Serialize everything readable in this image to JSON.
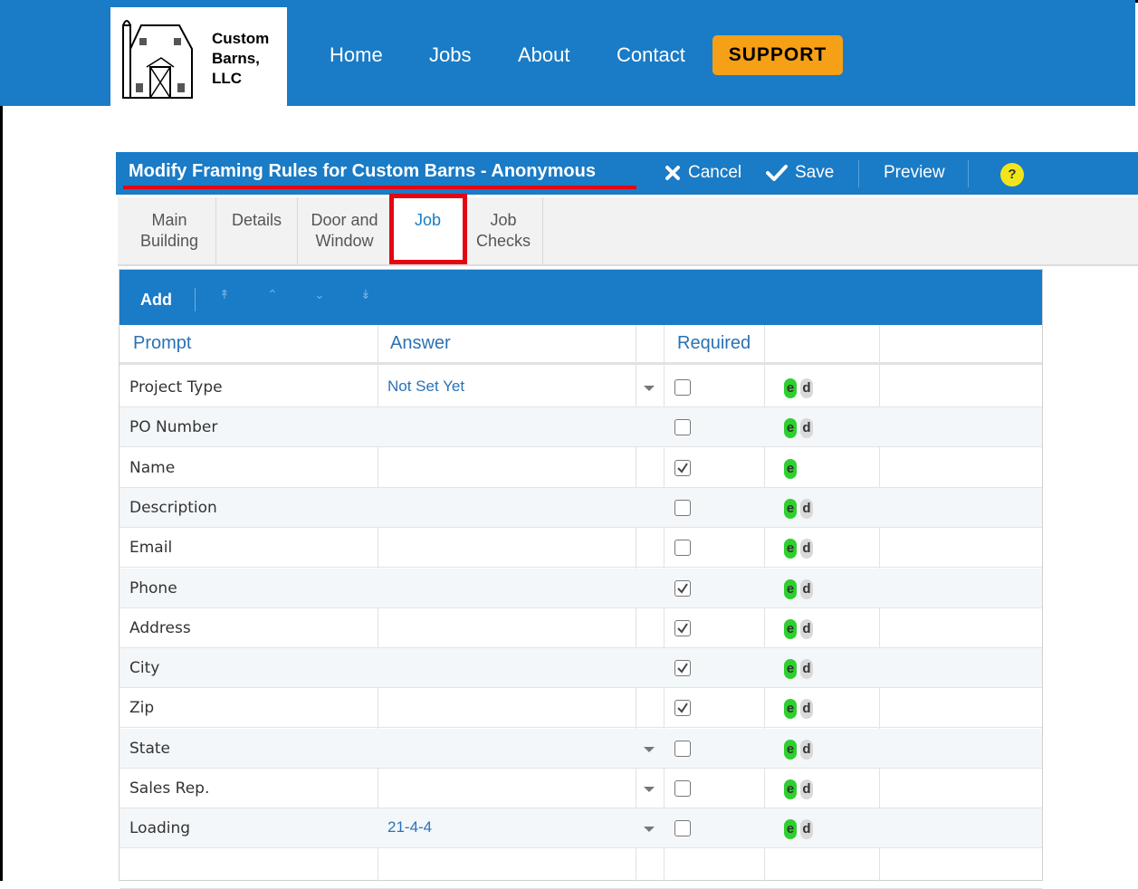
{
  "brand": {
    "logo_line1": "Custom",
    "logo_line2": "Barns,",
    "logo_line3": "LLC"
  },
  "nav": {
    "home": "Home",
    "jobs": "Jobs",
    "about": "About",
    "contact": "Contact",
    "support": "SUPPORT"
  },
  "titlebar": {
    "title": "Modify Framing Rules for Custom Barns - Anonymous",
    "cancel": "Cancel",
    "save": "Save",
    "preview": "Preview",
    "help": "?"
  },
  "tabs": [
    {
      "line1": "Main",
      "line2": "Building"
    },
    {
      "line1": "Details",
      "line2": ""
    },
    {
      "line1": "Door and",
      "line2": "Window"
    },
    {
      "line1": "Job",
      "line2": ""
    },
    {
      "line1": "Job",
      "line2": "Checks"
    }
  ],
  "grid": {
    "add_label": "Add",
    "columns": {
      "prompt": "Prompt",
      "answer": "Answer",
      "required": "Required"
    },
    "edit_label": "e",
    "delete_label": "d",
    "rows": [
      {
        "prompt": "Project Type",
        "answer": "Not Set Yet",
        "dropdown": true,
        "required": false,
        "deletable": true
      },
      {
        "prompt": "PO Number",
        "answer": "",
        "dropdown": false,
        "required": false,
        "deletable": true
      },
      {
        "prompt": "Name",
        "answer": "",
        "dropdown": false,
        "required": true,
        "deletable": false
      },
      {
        "prompt": "Description",
        "answer": "",
        "dropdown": false,
        "required": false,
        "deletable": true
      },
      {
        "prompt": "Email",
        "answer": "",
        "dropdown": false,
        "required": false,
        "deletable": true
      },
      {
        "prompt": "Phone",
        "answer": "",
        "dropdown": false,
        "required": true,
        "deletable": true
      },
      {
        "prompt": "Address",
        "answer": "",
        "dropdown": false,
        "required": true,
        "deletable": true
      },
      {
        "prompt": "City",
        "answer": "",
        "dropdown": false,
        "required": true,
        "deletable": true
      },
      {
        "prompt": "Zip",
        "answer": "",
        "dropdown": false,
        "required": true,
        "deletable": true
      },
      {
        "prompt": "State",
        "answer": "",
        "dropdown": true,
        "required": false,
        "deletable": true
      },
      {
        "prompt": "Sales Rep.",
        "answer": "",
        "dropdown": true,
        "required": false,
        "deletable": true
      },
      {
        "prompt": "Loading",
        "answer": "21-4-4",
        "dropdown": true,
        "required": false,
        "deletable": true
      }
    ]
  },
  "colors": {
    "primary": "#1a7bc6",
    "support": "#f6a017",
    "highlight": "#e30613",
    "edit": "#2dd02d"
  }
}
